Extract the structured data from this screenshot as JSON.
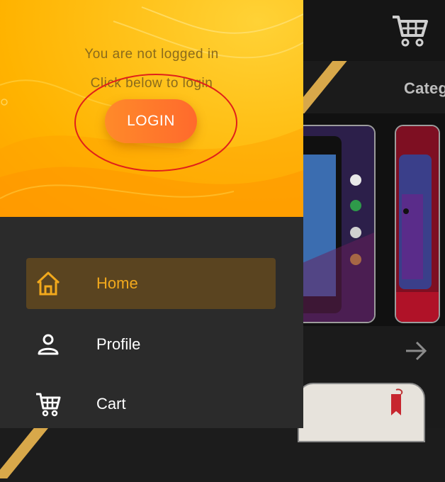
{
  "drawer": {
    "message_line1": "You are not logged in",
    "message_line2": "Click below to login",
    "login_label": "LOGIN",
    "menu": [
      {
        "label": "Home",
        "icon": "home-icon",
        "active": true
      },
      {
        "label": "Profile",
        "icon": "person-icon",
        "active": false
      },
      {
        "label": "Cart",
        "icon": "cart-icon",
        "active": false
      }
    ]
  },
  "background": {
    "category_heading": "Categ"
  },
  "colors": {
    "accent": "#f2a91c",
    "header_yellow": "#ffb300",
    "login_button": "#ff7a2b",
    "active_row": "#5a4420",
    "drawer_bg": "#2b2b2b",
    "annotation_circle": "#e0201a"
  }
}
